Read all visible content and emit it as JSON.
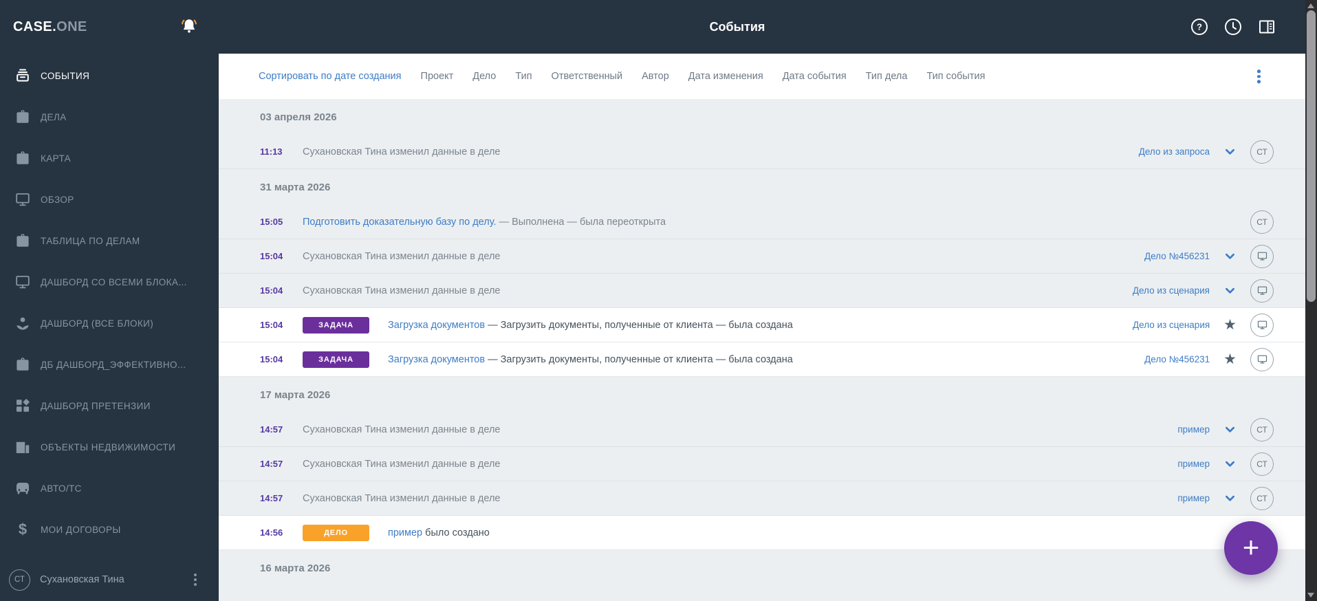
{
  "colors": {
    "accent_blue": "#3e7dc6",
    "time_purple": "#5639a3",
    "badge_task": "#6b2f9c",
    "badge_case": "#f9a229",
    "fab_purple": "#6d35a6"
  },
  "topbar": {
    "logo_primary": "CASE.",
    "logo_secondary": "ONE",
    "title": "События",
    "icons": [
      "bell-icon",
      "help-icon",
      "history-icon",
      "panel-icon"
    ]
  },
  "sidebar": {
    "items": [
      {
        "label": "СОБЫТИЯ",
        "icon": "events",
        "active": true
      },
      {
        "label": "ДЕЛА",
        "icon": "briefcase",
        "active": false
      },
      {
        "label": "КАРТА",
        "icon": "briefcase",
        "active": false
      },
      {
        "label": "ОБЗОР",
        "icon": "monitor",
        "active": false
      },
      {
        "label": "ТАБЛИЦА ПО ДЕЛАМ",
        "icon": "briefcase",
        "active": false
      },
      {
        "label": "ДАШБОРД СО ВСЕМИ БЛОКА...",
        "icon": "monitor",
        "active": false
      },
      {
        "label": "ДАШБОРД (ВСЕ БЛОКИ)",
        "icon": "spa",
        "active": false
      },
      {
        "label": "ДБ ДАШБОРД_ЭФФЕКТИВНО...",
        "icon": "briefcase",
        "active": false
      },
      {
        "label": "ДАШБОРД ПРЕТЕНЗИИ",
        "icon": "dashboard",
        "active": false
      },
      {
        "label": "ОБЪЕКТЫ НЕДВИЖИМОСТИ",
        "icon": "building",
        "active": false
      },
      {
        "label": "АВТО/ТС",
        "icon": "car",
        "active": false
      },
      {
        "label": "МОИ ДОГОВОРЫ",
        "icon": "dollar",
        "active": false
      }
    ],
    "user": {
      "initials": "СТ",
      "name": "Сухановская Тина"
    }
  },
  "filterbar": {
    "sort_label": "Сортировать по дате создания",
    "filters": [
      "Проект",
      "Дело",
      "Тип",
      "Ответственный",
      "Автор",
      "Дата изменения",
      "Дата события",
      "Тип дела",
      "Тип события"
    ]
  },
  "groups": [
    {
      "date": "03 апреля 2026",
      "events": [
        {
          "time": "11:13",
          "text": "Сухановская Тина изменил данные в деле",
          "case": "Дело из запроса",
          "marker": "chevron",
          "avatar": "СТ",
          "highlight": false
        }
      ]
    },
    {
      "date": "31 марта 2026",
      "events": [
        {
          "time": "15:05",
          "link": "Подготовить доказательную базу по делу.",
          "text": "— Выполнена — была переоткрыта",
          "avatar": "СТ",
          "highlight": false
        },
        {
          "time": "15:04",
          "text": "Сухановская Тина изменил данные в деле",
          "case": "Дело №456231",
          "marker": "chevron",
          "avatar": "monitor",
          "highlight": false
        },
        {
          "time": "15:04",
          "text": "Сухановская Тина изменил данные в деле",
          "case": "Дело из сценария",
          "marker": "chevron",
          "avatar": "monitor",
          "highlight": false
        },
        {
          "time": "15:04",
          "badge": "ЗАДАЧА",
          "badge_color": "badge_task",
          "link": "Загрузка документов",
          "text": "— Загрузить документы, полученные от клиента — была создана",
          "case": "Дело из сценария",
          "marker": "star",
          "avatar": "monitor",
          "highlight": true
        },
        {
          "time": "15:04",
          "badge": "ЗАДАЧА",
          "badge_color": "badge_task",
          "link": "Загрузка документов",
          "text": "— Загрузить документы, полученные от клиента — была создана",
          "case": "Дело №456231",
          "marker": "star",
          "avatar": "monitor",
          "highlight": true
        }
      ]
    },
    {
      "date": "17 марта 2026",
      "events": [
        {
          "time": "14:57",
          "text": "Сухановская Тина изменил данные в деле",
          "case": "пример",
          "marker": "chevron",
          "avatar": "СТ",
          "highlight": false
        },
        {
          "time": "14:57",
          "text": "Сухановская Тина изменил данные в деле",
          "case": "пример",
          "marker": "chevron",
          "avatar": "СТ",
          "highlight": false
        },
        {
          "time": "14:57",
          "text": "Сухановская Тина изменил данные в деле",
          "case": "пример",
          "marker": "chevron",
          "avatar": "СТ",
          "highlight": false
        },
        {
          "time": "14:56",
          "badge": "ДЕЛО",
          "badge_color": "badge_case",
          "link": "пример",
          "text": "было создано",
          "highlight": true
        }
      ]
    },
    {
      "date": "16 марта 2026",
      "events": []
    }
  ],
  "fab": {
    "label": "+"
  }
}
